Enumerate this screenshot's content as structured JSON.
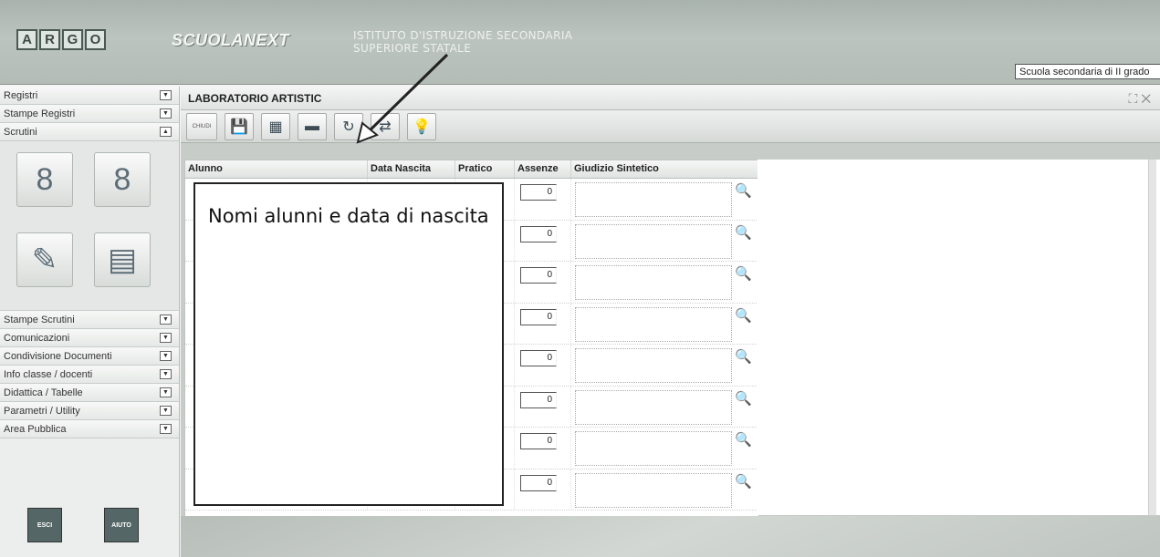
{
  "header": {
    "logo_letters": [
      "A",
      "R",
      "G",
      "O"
    ],
    "brand": "SCUOLANEXT",
    "institute_line1": "ISTITUTO D'ISTRUZIONE SECONDARIA",
    "institute_line2": "SUPERIORE STATALE",
    "school_level": "Scuola secondaria di II grado"
  },
  "sidebar": {
    "top_items": [
      {
        "label": "Registri"
      },
      {
        "label": "Stampe Registri"
      },
      {
        "label": "Scrutini"
      }
    ],
    "bottom_items": [
      {
        "label": "Stampe Scrutini"
      },
      {
        "label": "Comunicazioni"
      },
      {
        "label": "Condivisione Documenti"
      },
      {
        "label": "Info classe / docenti"
      },
      {
        "label": "Didattica / Tabelle"
      },
      {
        "label": "Parametri / Utility"
      },
      {
        "label": "Area Pubblica"
      }
    ],
    "exit_label": "ESCI",
    "help_label": "AIUTO"
  },
  "main": {
    "title": "LABORATORIO ARTISTIC",
    "close_label": "CHIUDI",
    "columns": [
      "Alunno",
      "Data Nascita",
      "Pratico",
      "Assenze",
      "Giudizio Sintetico"
    ],
    "rows": [
      {
        "assenze": "0"
      },
      {
        "assenze": "0"
      },
      {
        "assenze": "0"
      },
      {
        "assenze": "0"
      },
      {
        "assenze": "0"
      },
      {
        "assenze": "0"
      },
      {
        "assenze": "0"
      },
      {
        "assenze": "0"
      }
    ]
  },
  "annotation": {
    "text": "Nomi alunni e data di nascita"
  }
}
